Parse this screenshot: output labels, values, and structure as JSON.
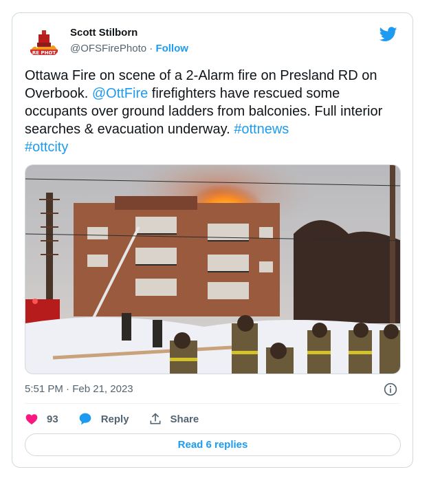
{
  "author": {
    "name": "Scott Stilborn",
    "handle": "@OFSFirePhoto",
    "separator": "·",
    "follow_label": "Follow"
  },
  "tweet": {
    "text_1": "Ottawa Fire on scene of a 2-Alarm fire on Presland RD on Overbook. ",
    "mention": "@OttFire",
    "text_2": " firefighters have rescued some occupants over ground ladders from balconies. Full interior searches & evacuation underway. ",
    "hashtag_1": "#ottnews",
    "hashtag_2": "#ottcity"
  },
  "meta": {
    "time": "5:51 PM",
    "separator": "·",
    "date": "Feb 21, 2023"
  },
  "actions": {
    "likes_count": "93",
    "reply_label": "Reply",
    "share_label": "Share"
  },
  "read_replies_label": "Read 6 replies",
  "icons": {
    "avatar": "fire-logo-avatar",
    "brand": "twitter-bird-icon",
    "info": "info-icon",
    "like": "heart-icon",
    "reply": "speech-bubble-icon",
    "share": "share-upload-icon"
  },
  "colors": {
    "accent": "#1d9bf0",
    "like": "#f91880",
    "text": "#0f1419",
    "muted": "#536471",
    "border": "#cfd9de"
  }
}
